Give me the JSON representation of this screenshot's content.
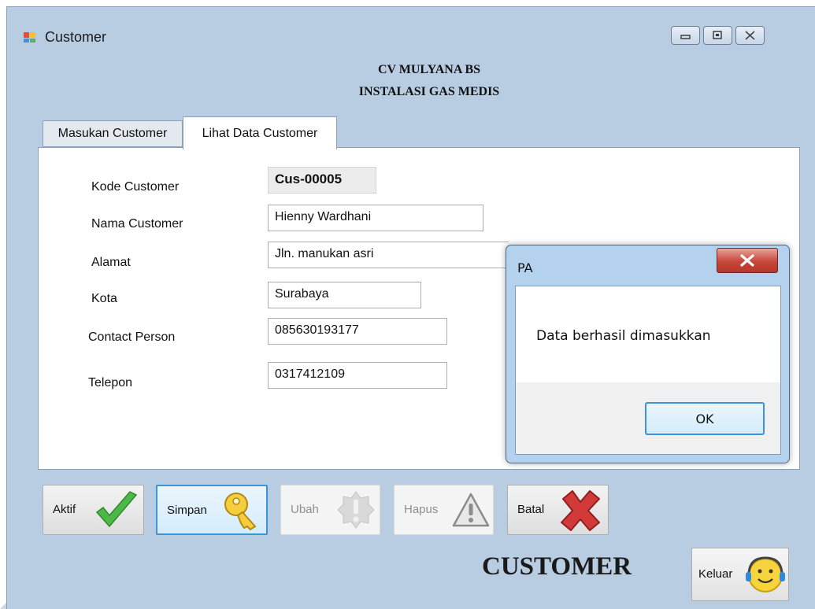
{
  "window": {
    "title": "Customer",
    "company_name": "CV MULYANA BS",
    "company_tagline": "INSTALASI GAS MEDIS"
  },
  "tabs": [
    {
      "label": "Masukan Customer",
      "active": false
    },
    {
      "label": "Lihat Data Customer",
      "active": true
    }
  ],
  "form": {
    "kode_label": "Kode Customer",
    "kode_value": "Cus-00005",
    "nama_label": "Nama Customer",
    "nama_value": "Hienny Wardhani",
    "alamat_label": "Alamat",
    "alamat_value": "Jln. manukan asri",
    "kota_label": "Kota",
    "kota_value": "Surabaya",
    "contact_label": "Contact Person",
    "contact_value": "085630193177",
    "telepon_label": "Telepon",
    "telepon_value": "0317412109"
  },
  "toolbar": {
    "aktif_label": "Aktif",
    "simpan_label": "Simpan",
    "ubah_label": "Ubah",
    "hapus_label": "Hapus",
    "batal_label": "Batal"
  },
  "footer": {
    "caption": "CUSTOMER",
    "keluar_label": "Keluar"
  },
  "dialog": {
    "title": "PA",
    "message": "Data berhasil dimasukkan",
    "ok_label": "OK"
  },
  "icons": {
    "aktif": "check-icon",
    "simpan": "key-icon",
    "ubah": "warning-badge-icon",
    "hapus": "warning-triangle-icon",
    "batal": "red-x-icon",
    "keluar": "smiley-headset-icon"
  },
  "colors": {
    "window_bg": "#b9cde2",
    "focus_border": "#3c93d8",
    "close_button": "#c8463a",
    "check_green": "#4cb848",
    "cancel_red": "#d23a3a"
  }
}
